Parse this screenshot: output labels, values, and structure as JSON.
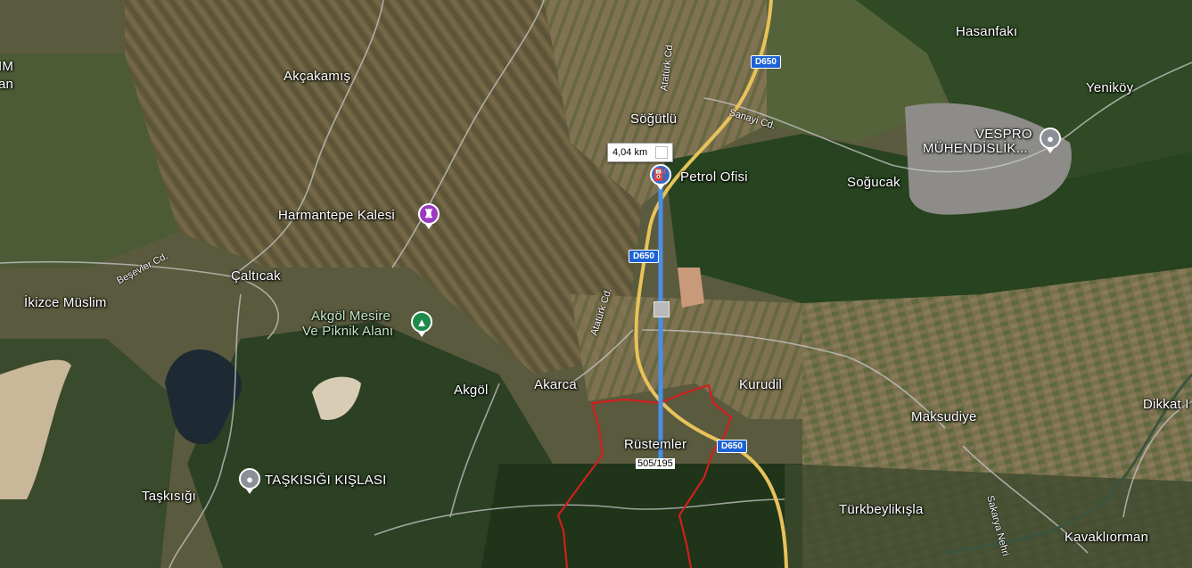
{
  "colors": {
    "measure_line": "#4a8fe8",
    "boundary": "#d01f1f",
    "highway": "#e8c25a",
    "road": "#c8c8c8",
    "poi_purple": "#9c3ac2",
    "poi_green": "#1e8a4a",
    "poi_grey": "#8a8f98",
    "poi_blue": "#3d66c7",
    "shield_blue": "#1e63d6"
  },
  "places": {
    "akcakamis": "Akçakamış",
    "sogutlu": "Söğütlü",
    "caltıcak": "Çaltıcak",
    "ikizce_muslim": "İkizce Müslim",
    "akgol": "Akgöl",
    "akarca": "Akarca",
    "kurudil": "Kurudil",
    "maksudiye": "Maksudiye",
    "rustemler": "Rüstemler",
    "tasKisigi": "Taşkısığı",
    "turkbeylikisla": "Türkbeylikışla",
    "kavakliorman": "Kavaklıorman",
    "hasanfaki": "Hasanfakı",
    "yenikoy": "Yeniköy",
    "sogucak": "Soğucak",
    "dikkat": "Dikkat I",
    "edge_top": "IM",
    "edge_bottom": "an"
  },
  "pois": {
    "harmantepe": {
      "label": "Harmantepe Kalesi",
      "icon": "castle-icon"
    },
    "akgol_mesire_line1": "Akgöl Mesire",
    "akgol_mesire_line2": "Ve Piknik Alanı",
    "akgol_mesire_icon": "tree-icon",
    "taskisigi_kislasi": {
      "label": "TAŞKISIĞI KIŞLASI",
      "icon": "place-icon"
    },
    "petrol_ofisi": {
      "label": "Petrol Ofisi",
      "icon": "fuel-icon"
    },
    "vespro_line1": "VESPRO",
    "vespro_line2": "MÜHENDİSLİK...",
    "vespro_icon": "place-icon"
  },
  "streets": {
    "ataturk_north": "Atatürk Cd.",
    "ataturk_south": "Atatürk Cd.",
    "sanayi": "Sanayi Cd.",
    "besevler": "Beşevler Cd.",
    "sakarya": "Sakarya Nehri"
  },
  "road_shields": {
    "top": "D650",
    "middle": "D650",
    "bottom": "D650"
  },
  "measurement": {
    "distance": "4,04 km"
  },
  "parcel_label": "505/195"
}
